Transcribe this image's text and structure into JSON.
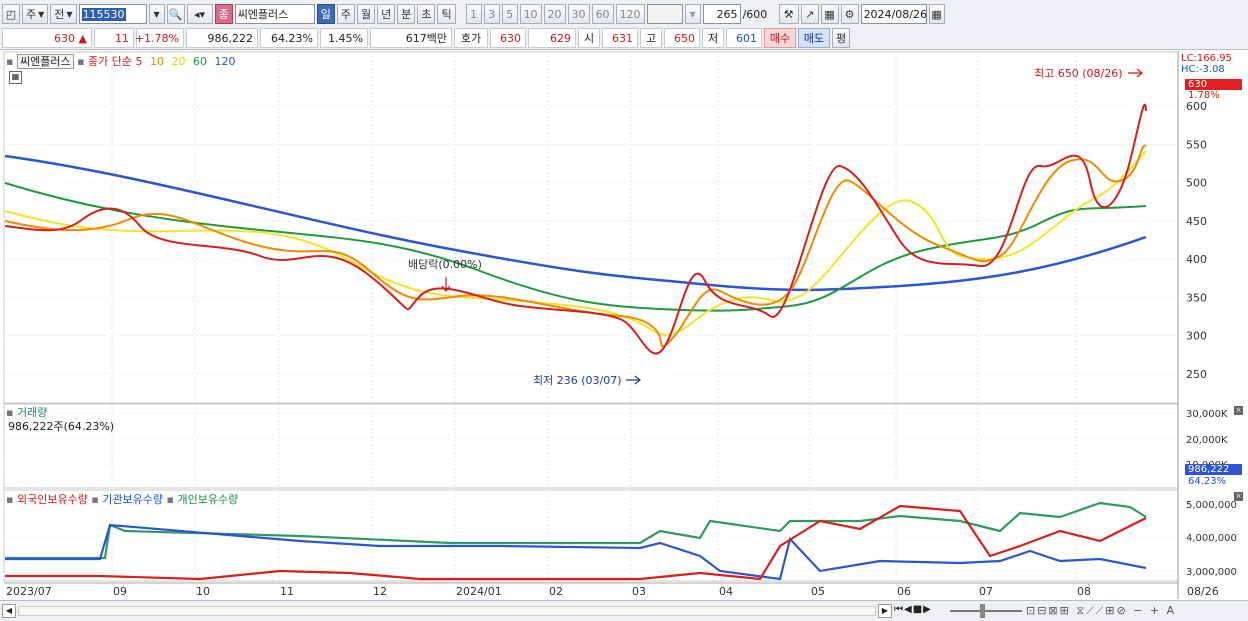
{
  "toolbar": {
    "market_a": "주",
    "market_b": "전",
    "code": "115530",
    "name_badge": "종",
    "name": "씨엔플러스",
    "periods": [
      "일",
      "주",
      "월",
      "년",
      "분",
      "초",
      "틱"
    ],
    "active_period": "일",
    "intervals": [
      "1",
      "3",
      "5",
      "10",
      "20",
      "30",
      "60",
      "120"
    ],
    "count": "265",
    "count_max": "/600",
    "date": "2024/08/26"
  },
  "quote": {
    "price": "630",
    "arrow": "▲",
    "change": "11",
    "change_pct": "+1.78%",
    "volume": "986,222",
    "volume_ratio": "64.23%",
    "turnover": "1.45%",
    "amount": "617백만",
    "ask_label": "호가",
    "ask1": "630",
    "ask2": "629",
    "open_label": "시",
    "open": "631",
    "high_label": "고",
    "high": "650",
    "low_label": "저",
    "low": "601",
    "buy_label": "매수",
    "sell_label": "매도",
    "eval_label": "평"
  },
  "price_panel": {
    "stock_name": "씨엔플러스",
    "legend_prefix": "종가 단순",
    "ma_periods": [
      "5",
      "10",
      "20",
      "60",
      "120"
    ],
    "ma_colors": [
      "#d81e1e",
      "#f08a00",
      "#f5e22a",
      "#1e9a3e",
      "#2c55d6"
    ],
    "lc": "LC:166.95",
    "hc": "HC:-3.08",
    "last_price": "630",
    "last_pct": "1.78%",
    "y_ticks": [
      "600",
      "550",
      "500",
      "450",
      "400",
      "350",
      "300",
      "250"
    ],
    "high_note": "최고 650 (08/26)",
    "low_note": "최저 236 (03/07)",
    "dividend_note": "배당락(0.00%)"
  },
  "volume_panel": {
    "title": "거래량",
    "info": "986,222주(64.23%)",
    "y_ticks": [
      "30,000K",
      "20,000K",
      "10,000K"
    ],
    "last": "986,222",
    "last_pct": "64.23%"
  },
  "holder_panel": {
    "series": [
      "외국인보유수량",
      "기관보유수량",
      "개인보유수량"
    ],
    "colors": [
      "#d81e1e",
      "#2c55d6",
      "#2e9a5c"
    ],
    "y_ticks": [
      "5,000,000",
      "4,000,000",
      "3,000,000"
    ]
  },
  "x_axis": {
    "labels": [
      "2023/07",
      "09",
      "10",
      "11",
      "12",
      "2024/01",
      "02",
      "03",
      "04",
      "05",
      "06",
      "07",
      "08",
      "08/26"
    ]
  }
}
